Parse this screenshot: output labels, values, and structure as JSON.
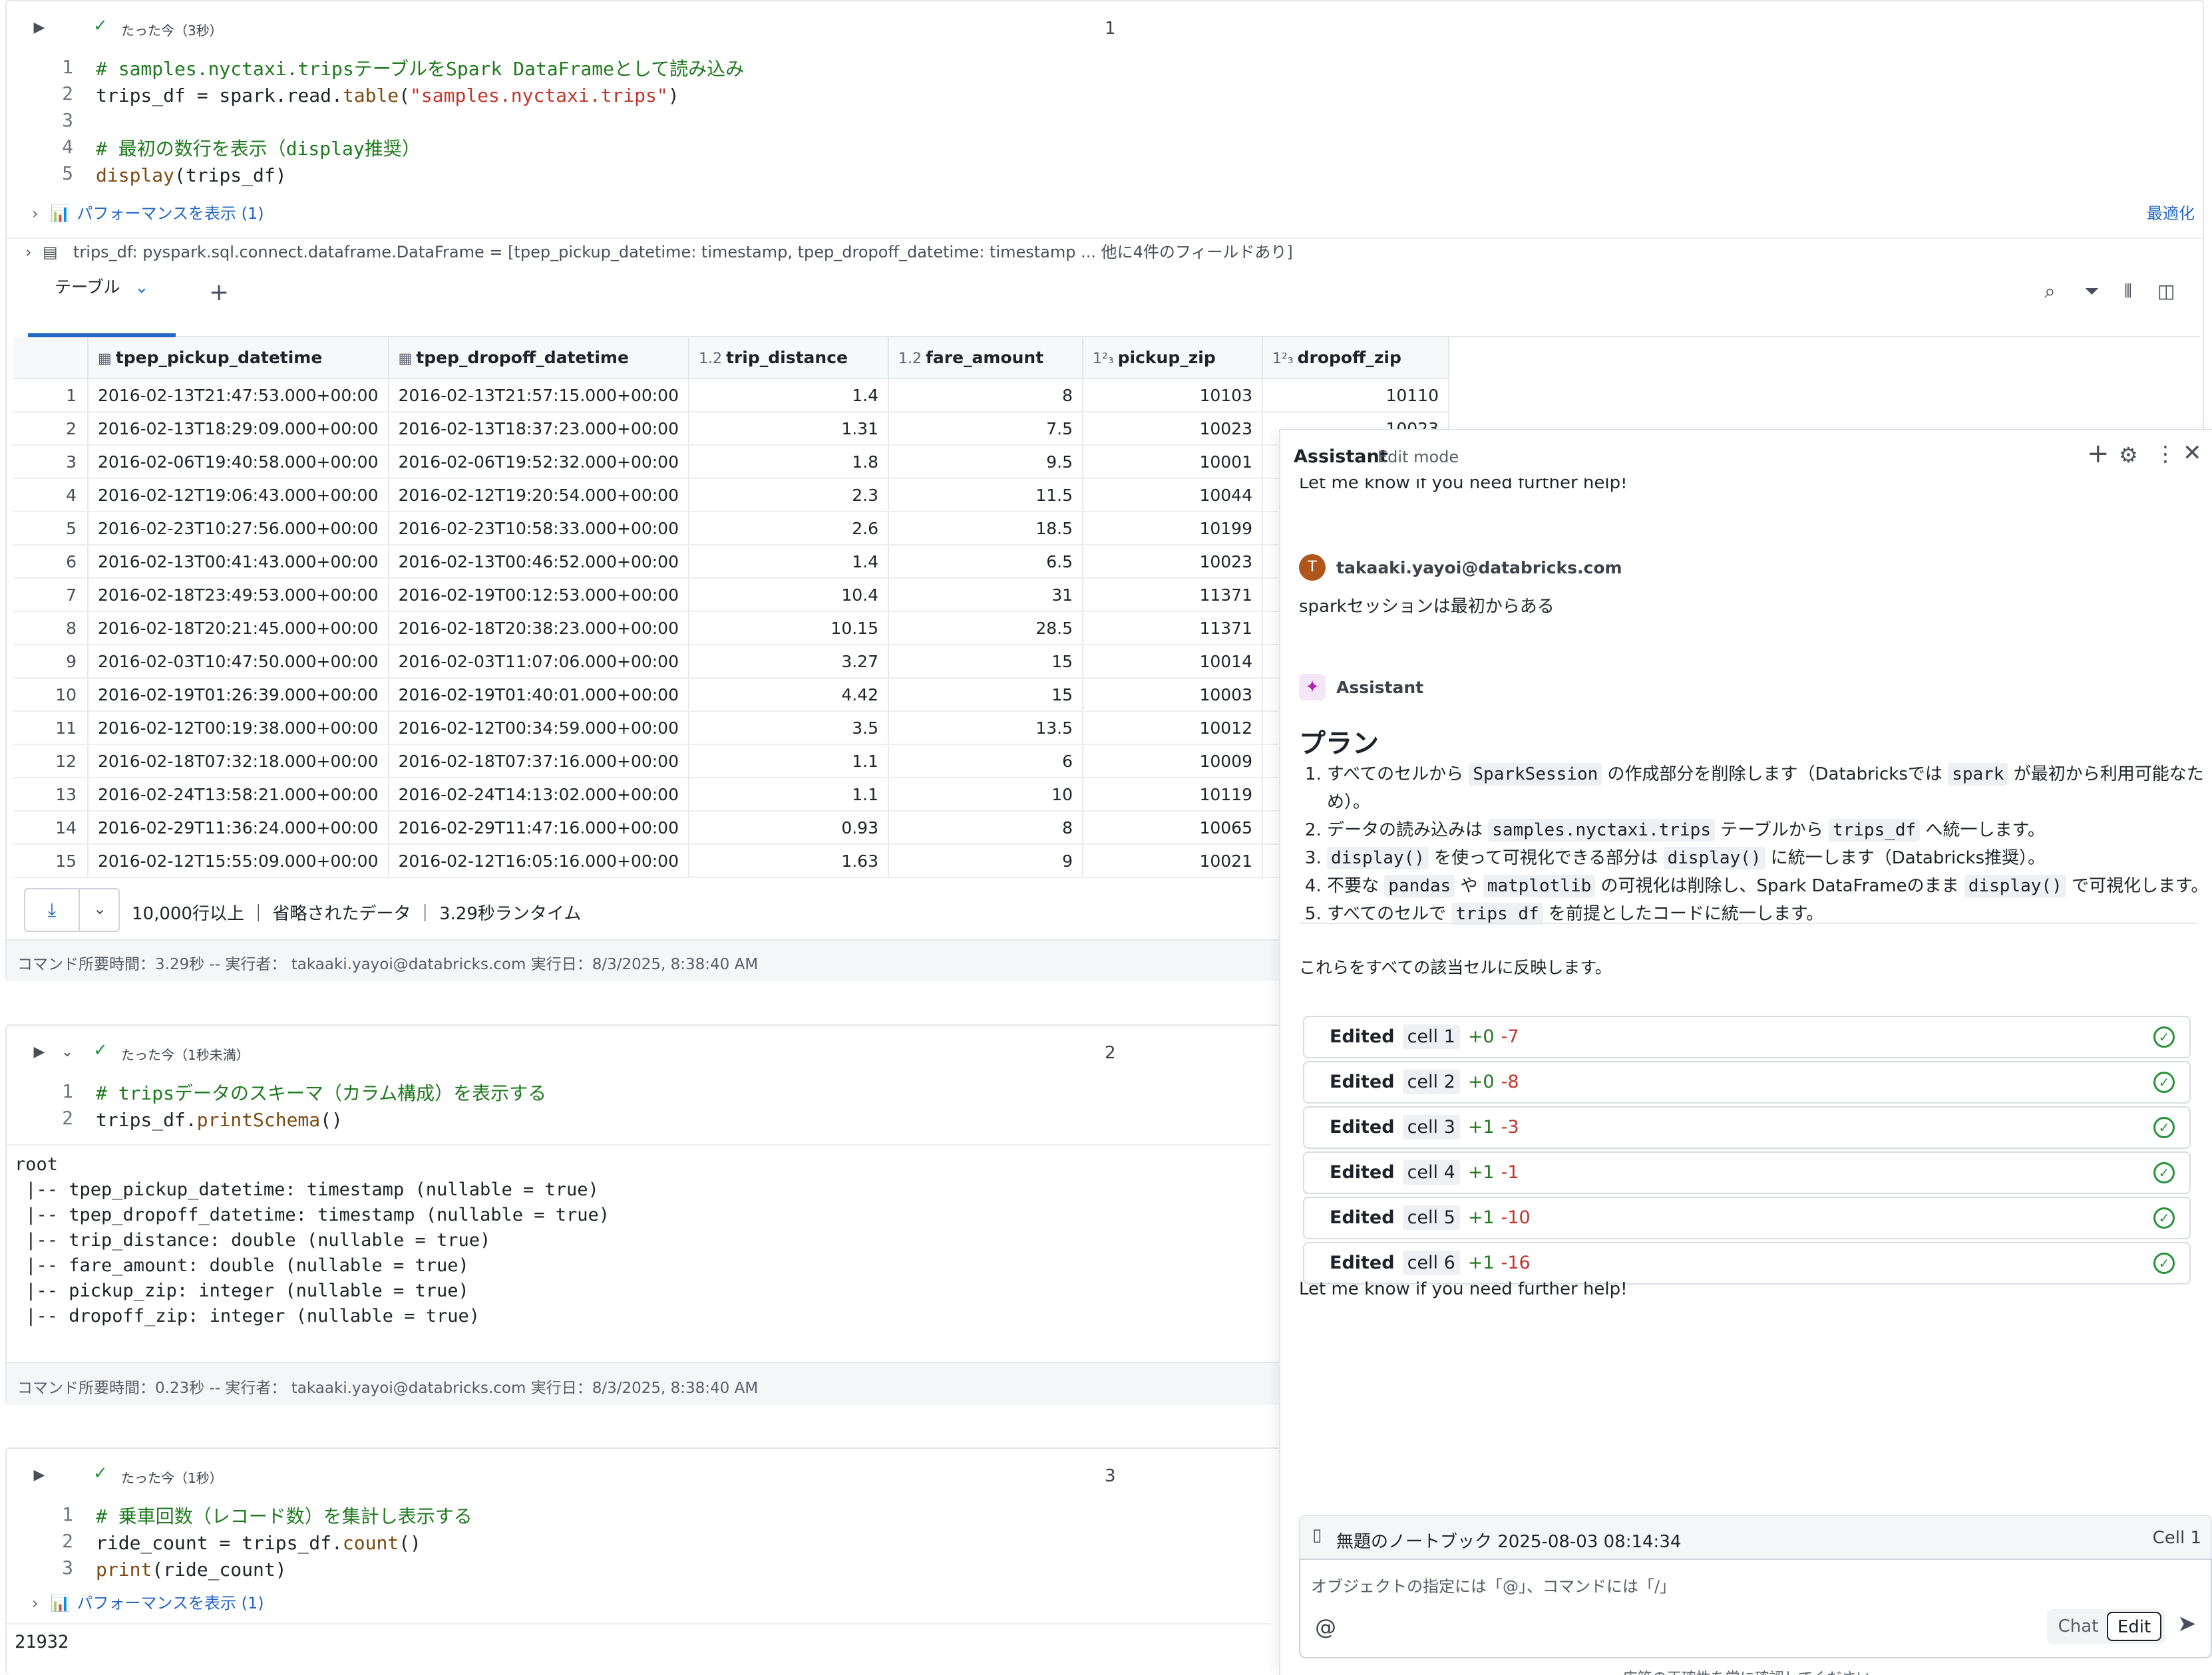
{
  "cell1": {
    "status": "たった今（3秒）",
    "number": "1",
    "lines": [
      {
        "n": "1",
        "comment": "# samples.nyctaxi.tripsテーブルをSpark DataFrameとして読み込み"
      },
      {
        "n": "2",
        "pre": "trips_df = spark.read.",
        "fn": "table",
        "open": "(",
        "str": "\"samples.nyctaxi.trips\"",
        "close": ")"
      },
      {
        "n": "3"
      },
      {
        "n": "4",
        "comment": "# 最初の数行を表示（display推奨）"
      },
      {
        "n": "5",
        "fn": "display",
        "rest": "(trips_df)"
      }
    ],
    "perf_label": "パフォーマンスを表示 (1)",
    "optimize_label": "最適化",
    "schema_line": "trips_df:  pyspark.sql.connect.dataframe.DataFrame = [tpep_pickup_datetime: timestamp, tpep_dropoff_datetime: timestamp ... 他に4件のフィールドあり]",
    "tab_label": "テーブル",
    "add_tab": "+",
    "table": {
      "columns": [
        {
          "icon": "calendar-icon",
          "glyph": "▦",
          "name": "tpep_pickup_datetime"
        },
        {
          "icon": "calendar-icon",
          "glyph": "▦",
          "name": "tpep_dropoff_datetime"
        },
        {
          "icon": "decimal-type-icon",
          "glyph": "1.2",
          "name": "trip_distance"
        },
        {
          "icon": "decimal-type-icon",
          "glyph": "1.2",
          "name": "fare_amount"
        },
        {
          "icon": "integer-type-icon",
          "glyph": "1²₃",
          "name": "pickup_zip"
        },
        {
          "icon": "integer-type-icon",
          "glyph": "1²₃",
          "name": "dropoff_zip"
        }
      ],
      "rows": [
        [
          "1",
          "2016-02-13T21:47:53.000+00:00",
          "2016-02-13T21:57:15.000+00:00",
          "1.4",
          "8",
          "10103",
          "10110"
        ],
        [
          "2",
          "2016-02-13T18:29:09.000+00:00",
          "2016-02-13T18:37:23.000+00:00",
          "1.31",
          "7.5",
          "10023",
          "10023"
        ],
        [
          "3",
          "2016-02-06T19:40:58.000+00:00",
          "2016-02-06T19:52:32.000+00:00",
          "1.8",
          "9.5",
          "10001",
          ""
        ],
        [
          "4",
          "2016-02-12T19:06:43.000+00:00",
          "2016-02-12T19:20:54.000+00:00",
          "2.3",
          "11.5",
          "10044",
          ""
        ],
        [
          "5",
          "2016-02-23T10:27:56.000+00:00",
          "2016-02-23T10:58:33.000+00:00",
          "2.6",
          "18.5",
          "10199",
          ""
        ],
        [
          "6",
          "2016-02-13T00:41:43.000+00:00",
          "2016-02-13T00:46:52.000+00:00",
          "1.4",
          "6.5",
          "10023",
          ""
        ],
        [
          "7",
          "2016-02-18T23:49:53.000+00:00",
          "2016-02-19T00:12:53.000+00:00",
          "10.4",
          "31",
          "11371",
          ""
        ],
        [
          "8",
          "2016-02-18T20:21:45.000+00:00",
          "2016-02-18T20:38:23.000+00:00",
          "10.15",
          "28.5",
          "11371",
          ""
        ],
        [
          "9",
          "2016-02-03T10:47:50.000+00:00",
          "2016-02-03T11:07:06.000+00:00",
          "3.27",
          "15",
          "10014",
          ""
        ],
        [
          "10",
          "2016-02-19T01:26:39.000+00:00",
          "2016-02-19T01:40:01.000+00:00",
          "4.42",
          "15",
          "10003",
          ""
        ],
        [
          "11",
          "2016-02-12T00:19:38.000+00:00",
          "2016-02-12T00:34:59.000+00:00",
          "3.5",
          "13.5",
          "10012",
          ""
        ],
        [
          "12",
          "2016-02-18T07:32:18.000+00:00",
          "2016-02-18T07:37:16.000+00:00",
          "1.1",
          "6",
          "10009",
          ""
        ],
        [
          "13",
          "2016-02-24T13:58:21.000+00:00",
          "2016-02-24T14:13:02.000+00:00",
          "1.1",
          "10",
          "10119",
          ""
        ],
        [
          "14",
          "2016-02-29T11:36:24.000+00:00",
          "2016-02-29T11:47:16.000+00:00",
          "0.93",
          "8",
          "10065",
          ""
        ],
        [
          "15",
          "2016-02-12T15:55:09.000+00:00",
          "2016-02-12T16:05:16.000+00:00",
          "1.63",
          "9",
          "10021",
          ""
        ]
      ]
    },
    "result_summary": "10,000行以上 ｜ 省略されたデータ ｜ 3.29秒ランタイム",
    "footer": "コマンド所要時間：3.29秒 -- 実行者： takaaki.yayoi@databricks.com 実行日：8/3/2025, 8:38:40 AM"
  },
  "cell2": {
    "status": "たった今（1秒未満）",
    "number": "2",
    "lines": [
      {
        "n": "1",
        "comment": "# tripsデータのスキーマ（カラム構成）を表示する"
      },
      {
        "n": "2",
        "pre": "trips_df.",
        "fn": "printSchema",
        "rest": "()"
      }
    ],
    "output": "root\n |-- tpep_pickup_datetime: timestamp (nullable = true)\n |-- tpep_dropoff_datetime: timestamp (nullable = true)\n |-- trip_distance: double (nullable = true)\n |-- fare_amount: double (nullable = true)\n |-- pickup_zip: integer (nullable = true)\n |-- dropoff_zip: integer (nullable = true)",
    "footer": "コマンド所要時間：0.23秒 -- 実行者： takaaki.yayoi@databricks.com 実行日：8/3/2025, 8:38:40 AM"
  },
  "cell3": {
    "status": "たった今（1秒）",
    "number": "3",
    "lines": [
      {
        "n": "1",
        "comment": "# 乗車回数（レコード数）を集計し表示する"
      },
      {
        "n": "2",
        "pre": "ride_count = trips_df.",
        "fn": "count",
        "rest": "()"
      },
      {
        "n": "3",
        "fn": "print",
        "rest": "(ride_count)"
      }
    ],
    "perf_label": "パフォーマンスを表示 (1)",
    "output": "21932"
  },
  "assistant": {
    "title": "Assistant",
    "mode": "Edit mode",
    "scrolled_text": "Let me know if you need further help!",
    "user_avatar": "T",
    "user_email": "takaaki.yayoi@databricks.com",
    "user_message": "sparkセッションは最初からある",
    "assistant_name": "Assistant",
    "plan_heading": "プラン",
    "plan_items": [
      [
        "すべてのセルから ",
        {
          "code": "SparkSession"
        },
        " の作成部分を削除します（Databricksでは ",
        {
          "code": "spark"
        },
        " が最初から利用可能なため）。"
      ],
      [
        "データの読み込みは ",
        {
          "code": "samples.nyctaxi.trips"
        },
        " テーブルから ",
        {
          "code": "trips_df"
        },
        " へ統一します。"
      ],
      [
        {
          "code": "display()"
        },
        " を使って可視化できる部分は ",
        {
          "code": "display()"
        },
        " に統一します（Databricks推奨）。"
      ],
      [
        "不要な ",
        {
          "code": "pandas"
        },
        " や ",
        {
          "code": "matplotlib"
        },
        " の可視化は削除し、Spark DataFrameのまま ",
        {
          "code": "display()"
        },
        " で可視化します。"
      ],
      [
        "すべてのセルで ",
        {
          "code": "trips_df"
        },
        " を前提としたコードに統一します。"
      ]
    ],
    "apply_text": "これらをすべての該当セルに反映します。",
    "edits": [
      {
        "label": "Edited",
        "cell": "cell 1",
        "plus": "+0",
        "minus": "-7"
      },
      {
        "label": "Edited",
        "cell": "cell 2",
        "plus": "+0",
        "minus": "-8"
      },
      {
        "label": "Edited",
        "cell": "cell 3",
        "plus": "+1",
        "minus": "-3"
      },
      {
        "label": "Edited",
        "cell": "cell 4",
        "plus": "+1",
        "minus": "-1"
      },
      {
        "label": "Edited",
        "cell": "cell 5",
        "plus": "+1",
        "minus": "-10"
      },
      {
        "label": "Edited",
        "cell": "cell 6",
        "plus": "+1",
        "minus": "-16"
      }
    ],
    "closing": "Let me know if you need further help!",
    "context_notebook": "無題のノートブック 2025-08-03 08:14:34",
    "context_cell": "Cell 1",
    "input_placeholder": "オブジェクトの指定には「@」、コマンドには「/」",
    "at_symbol": "@",
    "chat_label": "Chat",
    "edit_label": "Edit",
    "disclaimer": "応答の正確性を常に確認してください"
  },
  "colors": {
    "comment": "#1f7a1f",
    "string": "#c0362c",
    "link": "#2568c4",
    "success": "#27923c",
    "tab_active": "#2568c4"
  }
}
